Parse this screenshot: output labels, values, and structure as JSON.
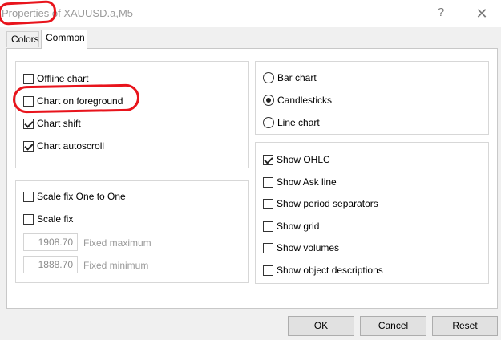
{
  "window": {
    "title": "Properties of XAUUSD.a,M5",
    "help_glyph": "?",
    "close_glyph": "✕"
  },
  "tabs": [
    {
      "label": "Colors",
      "active": false
    },
    {
      "label": "Common",
      "active": true
    }
  ],
  "chart_options": {
    "offline_chart": {
      "label": "Offline chart",
      "checked": false
    },
    "chart_on_foreground": {
      "label": "Chart on foreground",
      "checked": false
    },
    "chart_shift": {
      "label": "Chart shift",
      "checked": true
    },
    "chart_autoscroll": {
      "label": "Chart autoscroll",
      "checked": true
    }
  },
  "scale": {
    "scale_fix_one_to_one": {
      "label": "Scale fix One to One",
      "checked": false
    },
    "scale_fix": {
      "label": "Scale fix",
      "checked": false
    },
    "fixed_maximum": {
      "value": "1908.70",
      "label": "Fixed maximum"
    },
    "fixed_minimum": {
      "value": "1888.70",
      "label": "Fixed minimum"
    }
  },
  "chart_type": {
    "bar_chart": {
      "label": "Bar chart",
      "selected": false
    },
    "candlesticks": {
      "label": "Candlesticks",
      "selected": true
    },
    "line_chart": {
      "label": "Line chart",
      "selected": false
    }
  },
  "show_options": {
    "show_ohlc": {
      "label": "Show OHLC",
      "checked": true
    },
    "show_ask_line": {
      "label": "Show Ask line",
      "checked": false
    },
    "show_period_separators": {
      "label": "Show period separators",
      "checked": false
    },
    "show_grid": {
      "label": "Show grid",
      "checked": false
    },
    "show_volumes": {
      "label": "Show volumes",
      "checked": false
    },
    "show_object_descriptions": {
      "label": "Show object descriptions",
      "checked": false
    }
  },
  "buttons": {
    "ok": "OK",
    "cancel": "Cancel",
    "reset": "Reset"
  },
  "annotation_color": "#e8141c"
}
